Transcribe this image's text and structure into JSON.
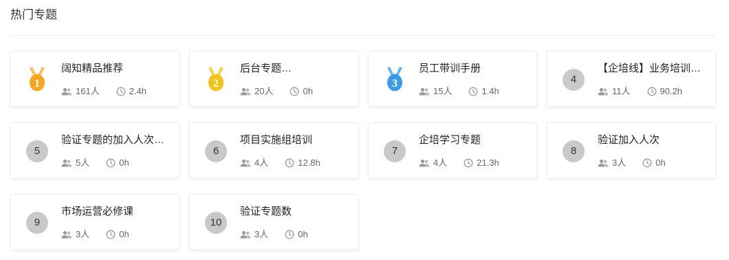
{
  "section_title": "热门专题",
  "colors": {
    "gold": "#F5A623",
    "yellow": "#F0C419",
    "blue": "#3A9CE6",
    "rank_bg": "#C9C9C9"
  },
  "topics": [
    {
      "rank": "1",
      "title": "阔知精品推荐",
      "members": "161人",
      "duration": "2.4h",
      "badge": "medal-orange"
    },
    {
      "rank": "2",
      "title": "后台专题…",
      "members": "20人",
      "duration": "0h",
      "badge": "medal-yellow"
    },
    {
      "rank": "3",
      "title": "员工带训手册",
      "members": "15人",
      "duration": "1.4h",
      "badge": "medal-blue"
    },
    {
      "rank": "4",
      "title": "【企培线】业务培训…",
      "members": "11人",
      "duration": "90.2h",
      "badge": "circle"
    },
    {
      "rank": "5",
      "title": "验证专题的加入人次…",
      "members": "5人",
      "duration": "0h",
      "badge": "circle"
    },
    {
      "rank": "6",
      "title": "项目实施组培训",
      "members": "4人",
      "duration": "12.8h",
      "badge": "circle"
    },
    {
      "rank": "7",
      "title": "企培学习专题",
      "members": "4人",
      "duration": "21.3h",
      "badge": "circle"
    },
    {
      "rank": "8",
      "title": "验证加入人次",
      "members": "3人",
      "duration": "0h",
      "badge": "circle"
    },
    {
      "rank": "9",
      "title": "市场运营必修课",
      "members": "3人",
      "duration": "0h",
      "badge": "circle"
    },
    {
      "rank": "10",
      "title": "验证专题数",
      "members": "3人",
      "duration": "0h",
      "badge": "circle"
    }
  ]
}
